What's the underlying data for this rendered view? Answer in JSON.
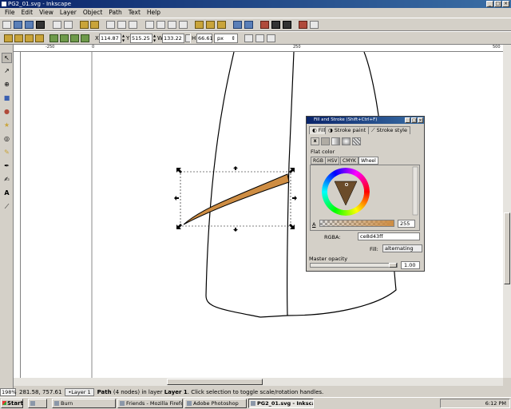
{
  "window": {
    "title": "PG2_01.svg - Inkscape"
  },
  "menu": [
    "File",
    "Edit",
    "View",
    "Layer",
    "Object",
    "Path",
    "Text",
    "Help"
  ],
  "select_toolbar": {
    "x_label": "X",
    "x_value": "114.87",
    "y_label": "Y",
    "y_value": "515.25",
    "w_label": "W",
    "w_value": "133.22",
    "h_label": "H",
    "h_value": "66.61",
    "units": "px"
  },
  "rulers": {
    "h_ticks": [
      "-250",
      "",
      "0",
      "",
      "250",
      "",
      "500"
    ]
  },
  "status": {
    "zoom": "198%",
    "coords": "281.58, 757.61",
    "layer": "•Layer 1",
    "msg_part1": "Path",
    "msg_part2": " (4 nodes) in layer ",
    "msg_part3": "Layer 1",
    "msg_part4": ". Click selection to toggle scale/rotation handles."
  },
  "fill_stroke": {
    "title": "Fill and Stroke (Shift+Ctrl+F)",
    "tab_fill": "Fill",
    "tab_stroke_paint": "Stroke paint",
    "tab_stroke_style": "Stroke style",
    "paint_x": "x",
    "flat_color": "Flat color",
    "subtab_rgb": "RGB",
    "subtab_hsv": "HSV",
    "subtab_cmyk": "CMYK",
    "subtab_wheel": "Wheel",
    "alpha_label": "A",
    "alpha_value": "255",
    "rgba_label": "RGBA:",
    "rgba_value": "ce8d43ff",
    "fill_rule_label": "Fill:",
    "fill_rule_value": "alternating",
    "master_opacity_label": "Master opacity",
    "master_opacity_value": "1.00",
    "master_opacity": 1.0,
    "color_hex": "#ce8d43"
  },
  "taskbar": {
    "start": "Start",
    "items": [
      "Burn",
      "Friends - Mozilla Firefox",
      "Adobe Photoshop",
      "PG2_01.svg - Inkscape"
    ],
    "time": "6:12 PM"
  },
  "colors": {
    "shape_fill": "#ce8d43",
    "titlebar": "#0a246a"
  }
}
